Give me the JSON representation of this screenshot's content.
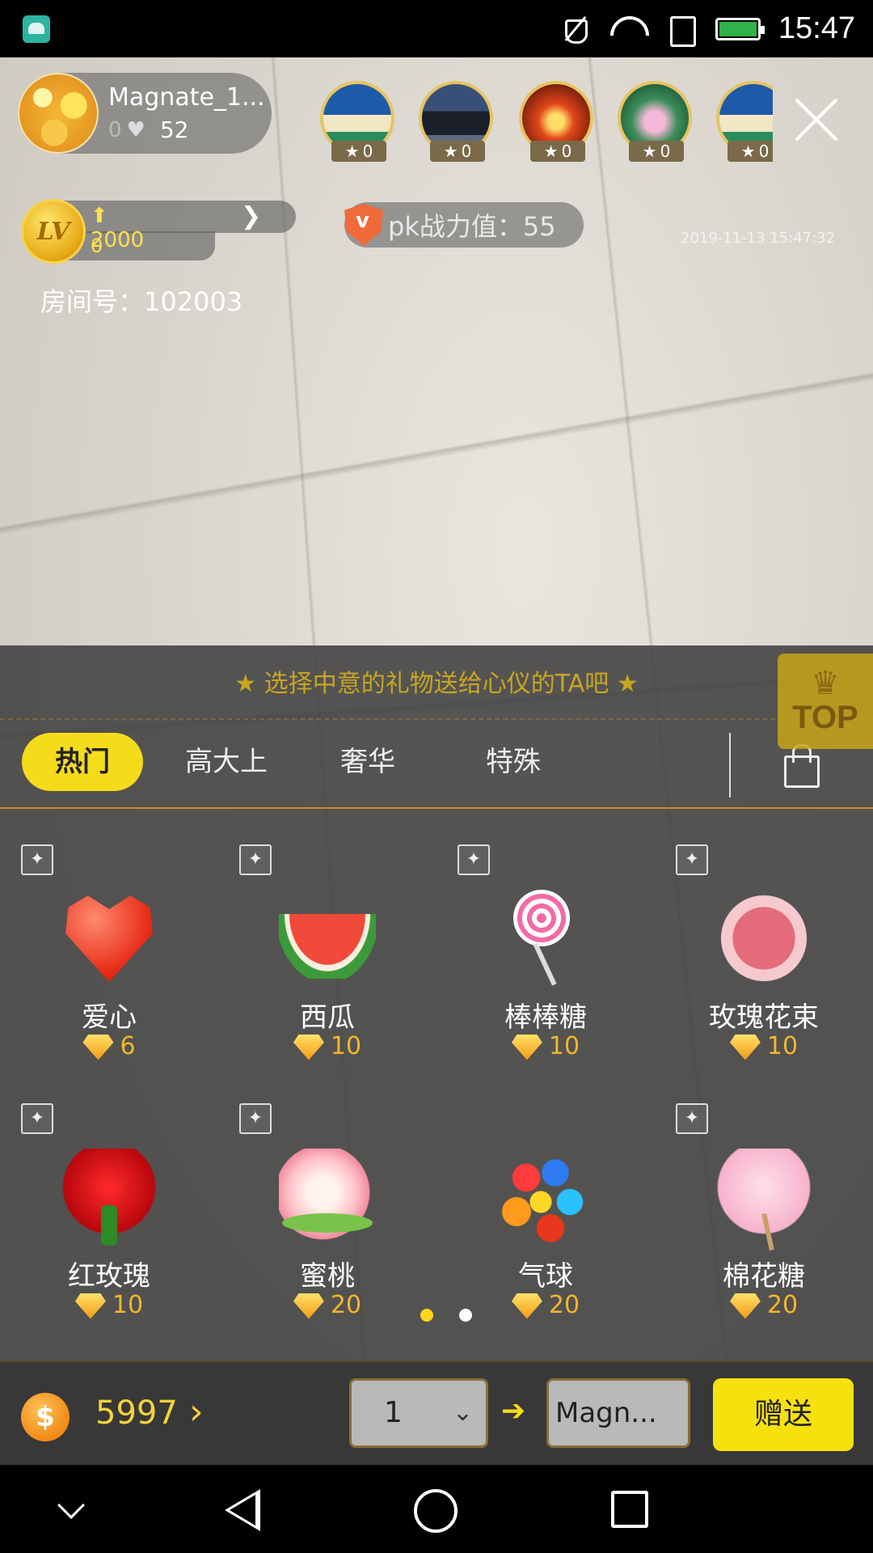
{
  "status_bar": {
    "time": "15:47"
  },
  "host": {
    "name": "Magnate_1...",
    "count_zero": "0",
    "likes": "52"
  },
  "viewers": [
    {
      "stars": "0"
    },
    {
      "stars": "0"
    },
    {
      "stars": "0"
    },
    {
      "stars": "0"
    },
    {
      "stars": "0"
    }
  ],
  "level": {
    "coin_label": "LV",
    "up_value": "2000",
    "current": "0"
  },
  "pk": {
    "label": "pk战力值：55"
  },
  "timestamp": "2019-11-13 15:47:32",
  "room": {
    "label": "房间号：102003"
  },
  "top_badge": {
    "label": "TOP"
  },
  "gift_panel": {
    "hint": "★ 选择中意的礼物送给心仪的TA吧 ★",
    "tabs": [
      "热门",
      "高大上",
      "奢华",
      "特殊"
    ],
    "gifts": [
      {
        "name": "爱心",
        "price": "6"
      },
      {
        "name": "西瓜",
        "price": "10"
      },
      {
        "name": "棒棒糖",
        "price": "10"
      },
      {
        "name": "玫瑰花束",
        "price": "10"
      },
      {
        "name": "红玫瑰",
        "price": "10"
      },
      {
        "name": "蜜桃",
        "price": "20"
      },
      {
        "name": "气球",
        "price": "20"
      },
      {
        "name": "棉花糖",
        "price": "20"
      }
    ],
    "page_current": 1,
    "page_total": 2
  },
  "bottom_bar": {
    "coin_symbol": "$",
    "balance": "5997",
    "quantity": "1",
    "recipient": "Magn...",
    "send_label": "赠送"
  }
}
